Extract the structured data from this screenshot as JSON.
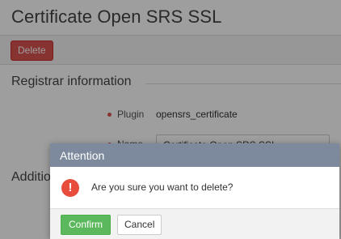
{
  "page": {
    "title": "Certificate Open SRS SSL",
    "delete_label": "Delete"
  },
  "registrar_section": {
    "title": "Registrar information",
    "fields": [
      {
        "label": "Plugin",
        "value": "opensrs_certificate"
      },
      {
        "label": "Name",
        "value": "Certificate Open SRS SSL"
      }
    ]
  },
  "additional_section": {
    "title": "Additional information"
  },
  "dialog": {
    "title": "Attention",
    "message": "Are you sure you want to delete?",
    "confirm_label": "Confirm",
    "cancel_label": "Cancel",
    "icon": "exclamation-circle-icon"
  },
  "colors": {
    "danger": "#d9534f",
    "success": "#5cb85c",
    "dialog_header": "#7d8a9e",
    "alert_icon": "#e74c3c"
  }
}
